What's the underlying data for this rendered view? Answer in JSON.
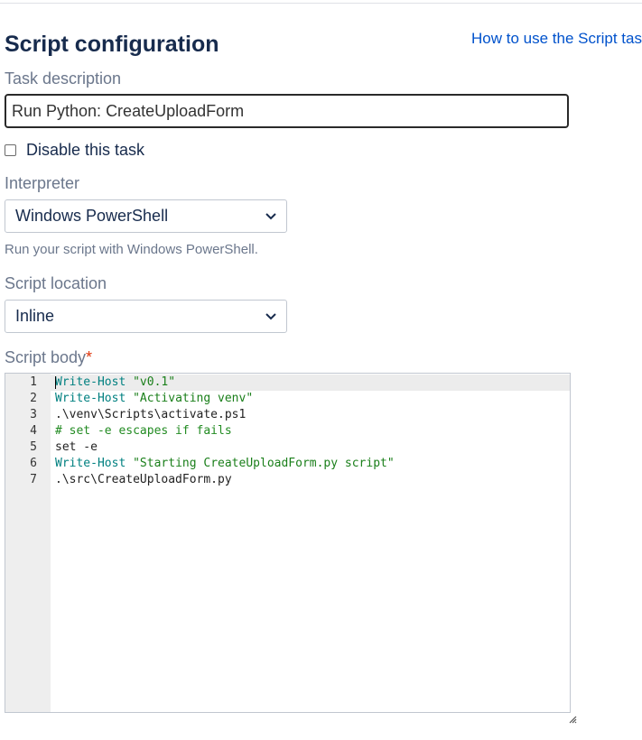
{
  "header": {
    "title": "Script configuration",
    "help_link": "How to use the Script task"
  },
  "task_description": {
    "label": "Task description",
    "value": "Run Python: CreateUploadForm"
  },
  "disable_task": {
    "label": "Disable this task",
    "checked": false
  },
  "interpreter": {
    "label": "Interpreter",
    "selected": "Windows PowerShell",
    "help_text": "Run your script with Windows PowerShell."
  },
  "script_location": {
    "label": "Script location",
    "selected": "Inline"
  },
  "script_body": {
    "label": "Script body",
    "required_marker": "*",
    "lines": [
      {
        "num": "1",
        "cmd": "Write-Host",
        "rest": " \"v0.1\"",
        "kind": "cmd-str"
      },
      {
        "num": "2",
        "cmd": "Write-Host",
        "rest": " \"Activating venv\"",
        "kind": "cmd-str"
      },
      {
        "num": "3",
        "cmd": "",
        "rest": ".\\venv\\Scripts\\activate.ps1",
        "kind": "plain"
      },
      {
        "num": "4",
        "cmd": "",
        "rest": "# set -e escapes if fails",
        "kind": "comment"
      },
      {
        "num": "5",
        "cmd": "",
        "rest": "set -e",
        "kind": "plain"
      },
      {
        "num": "6",
        "cmd": "Write-Host",
        "rest": " \"Starting CreateUploadForm.py script\"",
        "kind": "cmd-str"
      },
      {
        "num": "7",
        "cmd": "",
        "rest": ".\\src\\CreateUploadForm.py",
        "kind": "plain"
      }
    ]
  },
  "colors": {
    "link": "#0052cc",
    "required": "#de350b",
    "code_command": "#008080",
    "code_string": "#1a7f1a",
    "code_comment": "#228b22"
  },
  "icons": {
    "select_arrow": "chevron-down-icon",
    "resize": "resize-handle-icon"
  }
}
